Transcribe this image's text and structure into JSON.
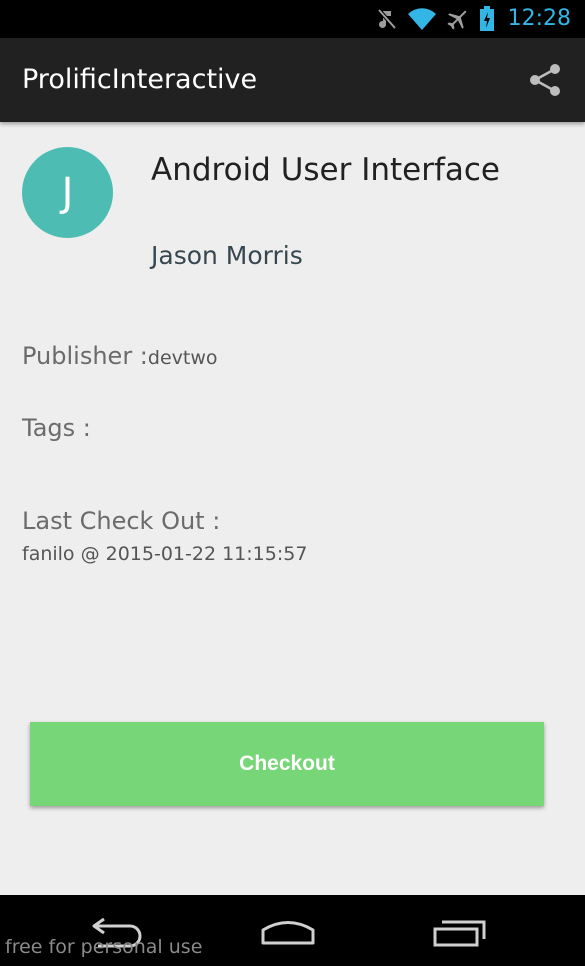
{
  "status_bar": {
    "time": "12:28",
    "icons": [
      "muted-icon",
      "wifi-icon",
      "airplane-icon",
      "battery-charging-icon"
    ],
    "time_color": "#33b5e5"
  },
  "action_bar": {
    "title": "ProlificInteractive",
    "share_icon": "share-icon"
  },
  "book": {
    "avatar_letter": "J",
    "avatar_color": "#4dbdb3",
    "title": "Android User Interface",
    "author": "Jason Morris"
  },
  "details": {
    "publisher_label": "Publisher :",
    "publisher_value": "devtwo",
    "tags_label": "Tags :",
    "last_checkout_label": "Last Check Out :",
    "last_checkout_value": "fanilo @ 2015-01-22 11:15:57"
  },
  "checkout_button": {
    "label": "Checkout",
    "color": "#77d677"
  },
  "nav_bar": {
    "icons": [
      "back-icon",
      "home-icon",
      "recent-apps-icon"
    ]
  },
  "watermark": "free for personal use"
}
